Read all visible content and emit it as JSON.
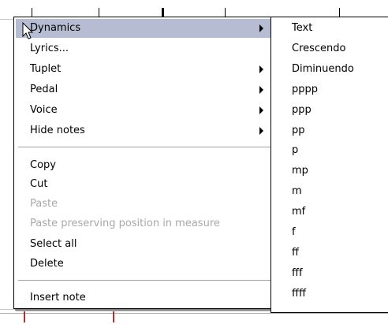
{
  "menu": {
    "items": [
      {
        "label": "Dynamics",
        "submenu": true,
        "state": "hover"
      },
      {
        "label": "Lyrics...",
        "submenu": false,
        "state": "normal"
      },
      {
        "label": "Tuplet",
        "submenu": true,
        "state": "normal"
      },
      {
        "label": "Pedal",
        "submenu": true,
        "state": "normal"
      },
      {
        "label": "Voice",
        "submenu": true,
        "state": "normal"
      },
      {
        "label": "Hide notes",
        "submenu": true,
        "state": "normal"
      },
      {
        "label": "Copy",
        "submenu": false,
        "state": "normal"
      },
      {
        "label": "Cut",
        "submenu": false,
        "state": "normal"
      },
      {
        "label": "Paste",
        "submenu": false,
        "state": "disabled"
      },
      {
        "label": "Paste preserving position in measure",
        "submenu": false,
        "state": "disabled"
      },
      {
        "label": "Select all",
        "submenu": false,
        "state": "normal"
      },
      {
        "label": "Delete",
        "submenu": false,
        "state": "normal"
      },
      {
        "label": "Insert note",
        "submenu": false,
        "state": "normal"
      }
    ]
  },
  "submenu": {
    "items": [
      "Text",
      "Crescendo",
      "Diminuendo",
      "pppp",
      "ppp",
      "pp",
      "p",
      "mp",
      "m",
      "mf",
      "f",
      "ff",
      "fff",
      "ffff"
    ]
  },
  "colors": {
    "hover_bg": "#b6bdd2",
    "disabled_text": "#a8a8a8"
  },
  "icons": {
    "cursor": "arrow-cursor-icon",
    "submenu_arrow": "chevron-right-icon"
  }
}
